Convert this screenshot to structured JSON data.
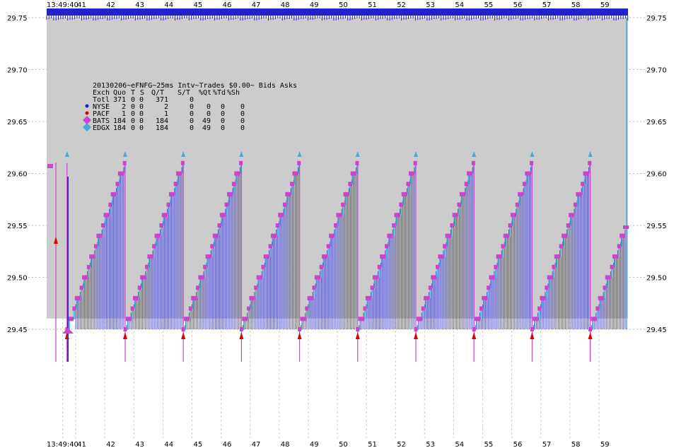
{
  "chart_data": {
    "type": "line",
    "title": "20130206~eFNFG~25ms Intv~Trades $0.00~ Bids  Asks",
    "ylim": [
      29.4,
      29.75
    ],
    "y_ticks": [
      "29.75",
      "29.70",
      "29.65",
      "29.60",
      "29.55",
      "29.50",
      "29.45"
    ],
    "y_tick_values": [
      29.75,
      29.7,
      29.65,
      29.6,
      29.55,
      29.5,
      29.45
    ],
    "x_start_label": "13:49:40",
    "x_ticks": [
      "41",
      "42",
      "43",
      "44",
      "45",
      "46",
      "47",
      "48",
      "49",
      "50",
      "51",
      "52",
      "53",
      "54",
      "55",
      "56",
      "57",
      "58",
      "59"
    ],
    "grid": true,
    "colors": {
      "plot_bg": "#cccccc",
      "bid": "#3333cc",
      "bats": "#cc44cc",
      "edgx": "#44aadd",
      "pacf": "#dd0000",
      "nyse": "#2222cc",
      "axis_bar": "#2222cc"
    },
    "legend": {
      "header": [
        "Exch",
        "Quo",
        "T",
        "S",
        "Q/T",
        "S/T",
        "%Qt",
        "%Td",
        "%Sh"
      ],
      "rows": [
        {
          "name": "Totl",
          "quo": "371",
          "t": "0",
          "s": "0",
          "qt": "371",
          "st": "0",
          "pqt": "",
          "ptd": "",
          "psh": "",
          "marker": "none"
        },
        {
          "name": "NYSE",
          "quo": "2",
          "t": "0",
          "s": "0",
          "qt": "2",
          "st": "0",
          "pqt": "0",
          "ptd": "0",
          "psh": "0",
          "marker": "nyse-dot"
        },
        {
          "name": "PACF",
          "quo": "1",
          "t": "0",
          "s": "0",
          "qt": "1",
          "st": "0",
          "pqt": "0",
          "ptd": "0",
          "psh": "0",
          "marker": "pacf-dot"
        },
        {
          "name": "BATS",
          "quo": "184",
          "t": "0",
          "s": "0",
          "qt": "184",
          "st": "0",
          "pqt": "49",
          "ptd": "0",
          "psh": "0",
          "marker": "bats-diamond"
        },
        {
          "name": "EDGX",
          "quo": "184",
          "t": "0",
          "s": "0",
          "qt": "184",
          "st": "0",
          "pqt": "49",
          "ptd": "0",
          "psh": "0",
          "marker": "edgx-diamond"
        }
      ]
    },
    "series": [
      {
        "name": "Bids",
        "pattern": "sawtooth",
        "period_s": 2,
        "low": 29.45,
        "high": 29.61,
        "cycles": 10
      },
      {
        "name": "Asks",
        "values_const": 29.75
      }
    ]
  }
}
